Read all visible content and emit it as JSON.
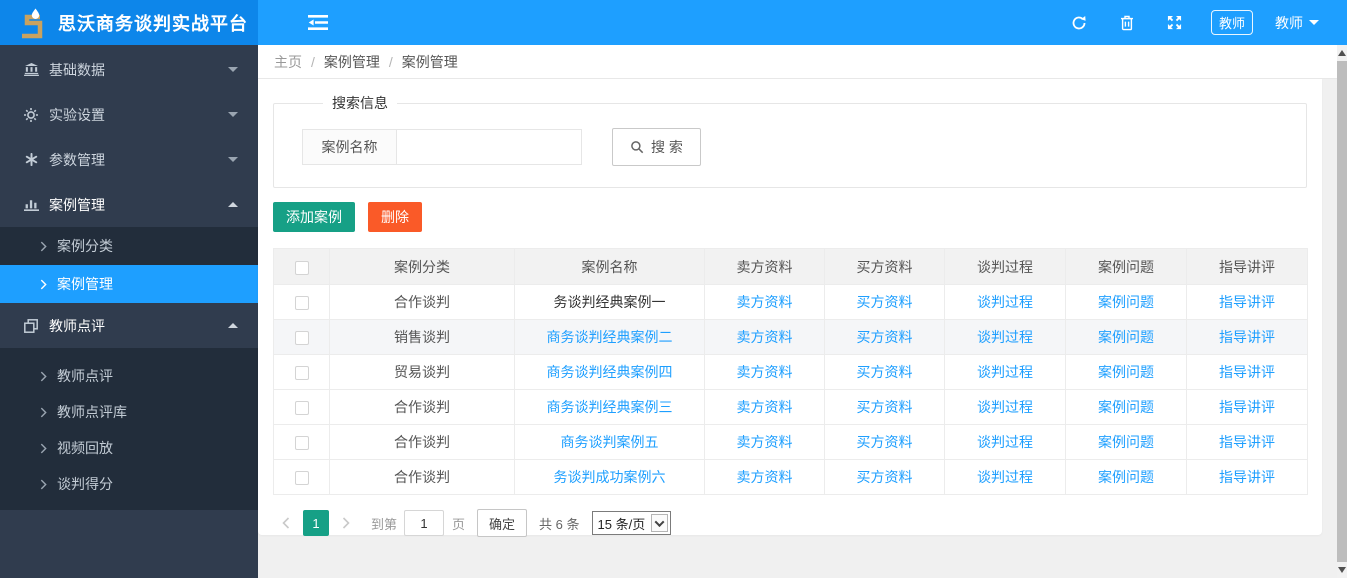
{
  "header": {
    "title": "思沃商务谈判实战平台",
    "role_badge": "教师",
    "user_name": "教师"
  },
  "sidebar": {
    "items": [
      {
        "label": "基础数据",
        "icon": "bank-icon",
        "expanded": false
      },
      {
        "label": "实验设置",
        "icon": "gear-icon",
        "expanded": false
      },
      {
        "label": "参数管理",
        "icon": "asterisk-icon",
        "expanded": false
      },
      {
        "label": "案例管理",
        "icon": "chart-icon",
        "expanded": true,
        "children": [
          {
            "label": "案例分类",
            "active": false
          },
          {
            "label": "案例管理",
            "active": true
          }
        ]
      },
      {
        "label": "教师点评",
        "icon": "window-icon",
        "expanded": true,
        "children": [
          {
            "label": "教师点评",
            "active": false
          },
          {
            "label": "教师点评库",
            "active": false
          },
          {
            "label": "视频回放",
            "active": false
          },
          {
            "label": "谈判得分",
            "active": false
          }
        ]
      }
    ]
  },
  "breadcrumb": {
    "items": [
      "主页",
      "案例管理",
      "案例管理"
    ],
    "separator": "/"
  },
  "search": {
    "legend": "搜索信息",
    "field_label": "案例名称",
    "input_value": "",
    "button_label": "搜 索"
  },
  "toolbar": {
    "add_label": "添加案例",
    "delete_label": "删除"
  },
  "table": {
    "headers": [
      "案例分类",
      "案例名称",
      "卖方资料",
      "买方资料",
      "谈判过程",
      "案例问题",
      "指导讲评"
    ],
    "link_labels": [
      "卖方资料",
      "买方资料",
      "谈判过程",
      "案例问题",
      "指导讲评"
    ],
    "rows": [
      {
        "category": "合作谈判",
        "name": "务谈判经典案例一",
        "name_is_link": false
      },
      {
        "category": "销售谈判",
        "name": "商务谈判经典案例二",
        "name_is_link": true
      },
      {
        "category": "贸易谈判",
        "name": "商务谈判经典案例四",
        "name_is_link": true
      },
      {
        "category": "合作谈判",
        "name": "商务谈判经典案例三",
        "name_is_link": true
      },
      {
        "category": "合作谈判",
        "name": "商务谈判案例五",
        "name_is_link": true
      },
      {
        "category": "合作谈判",
        "name": "务谈判成功案例六",
        "name_is_link": true
      }
    ]
  },
  "pagination": {
    "current_page": "1",
    "goto_prefix": "到第",
    "goto_value": "1",
    "goto_suffix": "页",
    "confirm_label": "确定",
    "total_label": "共 6 条",
    "page_size": "15 条/页"
  },
  "colors": {
    "header_blue": "#1e9fff",
    "logo_blue": "#0d86ea",
    "sidebar_dark": "#303c4e",
    "active_blue": "#1e9fff",
    "teal": "#16a086",
    "orange": "#fa5a28",
    "link_blue": "#1e9fff"
  }
}
